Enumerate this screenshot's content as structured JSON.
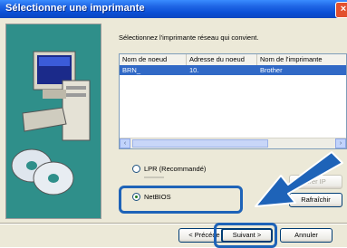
{
  "window": {
    "title": "Sélectionner une imprimante"
  },
  "instruction": "Sélectionnez l'imprimante réseau qui convient.",
  "list": {
    "columns": [
      "Nom de noeud",
      "Adresse du noeud",
      "Nom de l'imprimante"
    ],
    "rows": [
      {
        "node": "BRN_",
        "address": "10.",
        "printer": "Brother"
      }
    ]
  },
  "options": {
    "lpr_label": "LPR (Recommandé)",
    "netbios_label": "NetBIOS",
    "selected": "NetBIOS"
  },
  "buttons": {
    "config_ip": "urer IP",
    "refresh": "Rafraîchir",
    "back": "< Précéde",
    "next": "Suivant >",
    "cancel": "Annuler"
  },
  "colors": {
    "highlight": "#1e63b8",
    "selection": "#3169c6",
    "arrow": "#1e63b8"
  }
}
